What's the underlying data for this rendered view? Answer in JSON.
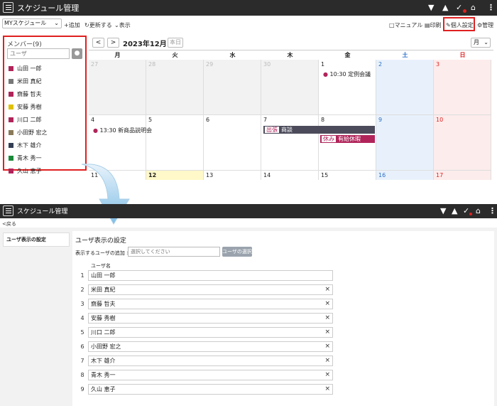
{
  "top": {
    "app_title": "スケジュール管理",
    "toolbar": {
      "view_select": "MYスケジュール",
      "add": "追加",
      "update": "更新する",
      "display": "表示",
      "manual": "マニュアル",
      "print": "印刷",
      "personal_settings": "個人設定",
      "admin": "管理"
    },
    "sidebar": {
      "title": "メンバー(9)",
      "search_placeholder": "ユーザ",
      "members": [
        {
          "name": "山田 一郎",
          "color": "#b0245a"
        },
        {
          "name": "米田 真紀",
          "color": "#777777"
        },
        {
          "name": "齋藤 哲夫",
          "color": "#b0245a"
        },
        {
          "name": "安藤 秀樹",
          "color": "#e0c000"
        },
        {
          "name": "川口 二郎",
          "color": "#b0245a"
        },
        {
          "name": "小田野 宏之",
          "color": "#8a7a5a"
        },
        {
          "name": "木下 雄介",
          "color": "#333d55"
        },
        {
          "name": "青木 秀一",
          "color": "#1a8a3a"
        },
        {
          "name": "久山 恵子",
          "color": "#b0245a"
        }
      ]
    },
    "calendar": {
      "prev": "<",
      "next": ">",
      "month": "2023年12月",
      "today": "本日",
      "view": "月",
      "weekdays": [
        "月",
        "火",
        "水",
        "木",
        "金",
        "土",
        "日"
      ],
      "week1": [
        "27",
        "28",
        "29",
        "30",
        "1",
        "2",
        "3"
      ],
      "week2": [
        "4",
        "5",
        "6",
        "7",
        "8",
        "9",
        "10"
      ],
      "week3": [
        "11",
        "12",
        "13",
        "14",
        "15",
        "16",
        "17"
      ],
      "events": {
        "e1": "10:30 定例会議",
        "e2": "13:30 新商品説明会",
        "bar1_tag": "出張",
        "bar1_text": "商談",
        "bar2_tag": "休み",
        "bar2_text": "有給休暇"
      }
    }
  },
  "bottom": {
    "app_title": "スケジュール管理",
    "back": "戻る",
    "left_menu": "ユーザ表示の設定",
    "heading": "ユーザ表示の設定",
    "add_label": "表示するユーザの追加 >",
    "add_placeholder": "選択してください",
    "select_button": "ユーザの選択",
    "col_header": "ユーザ名",
    "rows": [
      {
        "num": "1",
        "name": "山田 一郎"
      },
      {
        "num": "2",
        "name": "米田 真紀"
      },
      {
        "num": "3",
        "name": "齋藤 哲夫"
      },
      {
        "num": "4",
        "name": "安藤 秀樹"
      },
      {
        "num": "5",
        "name": "川口 二郎"
      },
      {
        "num": "6",
        "name": "小田野 宏之"
      },
      {
        "num": "7",
        "name": "木下 雄介"
      },
      {
        "num": "8",
        "name": "青木 秀一"
      },
      {
        "num": "9",
        "name": "久山 恵子"
      }
    ],
    "remove_glyph": "×"
  }
}
